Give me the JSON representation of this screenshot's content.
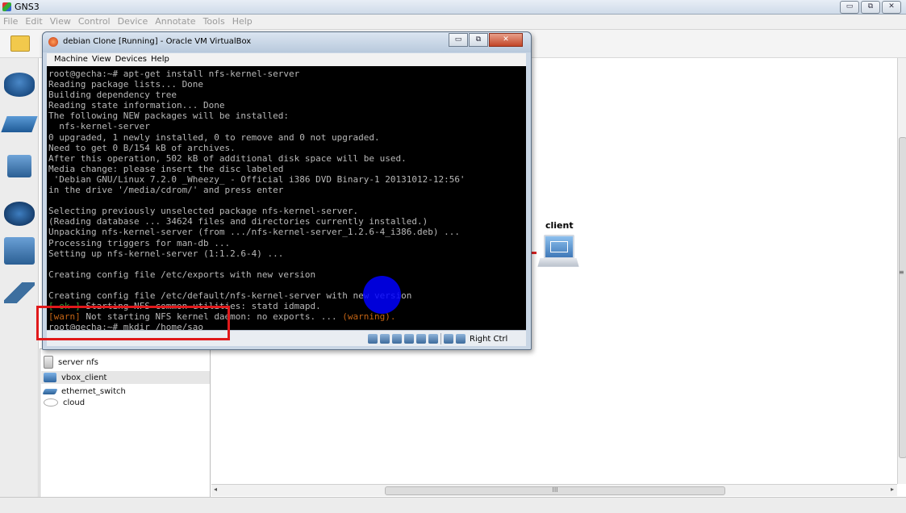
{
  "gns3": {
    "title": "GNS3",
    "window_controls": [
      "▭",
      "⧉",
      "✕"
    ],
    "menu": [
      "File",
      "Edit",
      "View",
      "Control",
      "Device",
      "Annotate",
      "Tools",
      "Help"
    ]
  },
  "node_list": [
    {
      "label": "server nfs",
      "icon": "server-icon",
      "selected": false
    },
    {
      "label": "vbox_client",
      "icon": "pc-icon",
      "selected": true
    },
    {
      "label": "ethernet_switch",
      "icon": "switch-icon",
      "selected": false
    },
    {
      "label": "cloud",
      "icon": "cloud-icon",
      "selected": false
    }
  ],
  "canvas": {
    "client_label": "client",
    "hscroll_grip": "III",
    "vscroll_grip": "≡"
  },
  "vbox": {
    "title": "debian Clone [Running] - Oracle VM VirtualBox",
    "window_controls": [
      "▭",
      "⧉",
      "✕"
    ],
    "menu": [
      "Machine",
      "View",
      "Devices",
      "Help"
    ],
    "host_key": "Right Ctrl",
    "terminal": {
      "lines": [
        "root@gecha:~# apt-get install nfs-kernel-server",
        "Reading package lists... Done",
        "Building dependency tree",
        "Reading state information... Done",
        "The following NEW packages will be installed:",
        "  nfs-kernel-server",
        "0 upgraded, 1 newly installed, 0 to remove and 0 not upgraded.",
        "Need to get 0 B/154 kB of archives.",
        "After this operation, 502 kB of additional disk space will be used.",
        "Media change: please insert the disc labeled",
        " 'Debian GNU/Linux 7.2.0 _Wheezy_ - Official i386 DVD Binary-1 20131012-12:56'",
        "in the drive '/media/cdrom/' and press enter",
        "",
        "Selecting previously unselected package nfs-kernel-server.",
        "(Reading database ... 34624 files and directories currently installed.)",
        "Unpacking nfs-kernel-server (from .../nfs-kernel-server_1.2.6-4_i386.deb) ...",
        "Processing triggers for man-db ...",
        "Setting up nfs-kernel-server (1:1.2.6-4) ...",
        "",
        "Creating config file /etc/exports with new version",
        "",
        "Creating config file /etc/default/nfs-kernel-server with new version"
      ],
      "ok_prefix": "[ ok ]",
      "ok_text": " Starting NFS common utilities: statd idmapd.",
      "warn_prefix": "[warn]",
      "warn_text": " Not starting NFS kernel daemon: no exports. ... ",
      "warn_suffix": "(warning).",
      "prompt_line": "root@gecha:~# mkdir /home/sao_"
    }
  },
  "colors": {
    "highlight": "#e0191b",
    "cursor": "#0000ff",
    "terminal_bg": "#000000",
    "terminal_fg": "#b8b8b8",
    "warn": "#c46414",
    "ok": "#3b9a3b"
  }
}
